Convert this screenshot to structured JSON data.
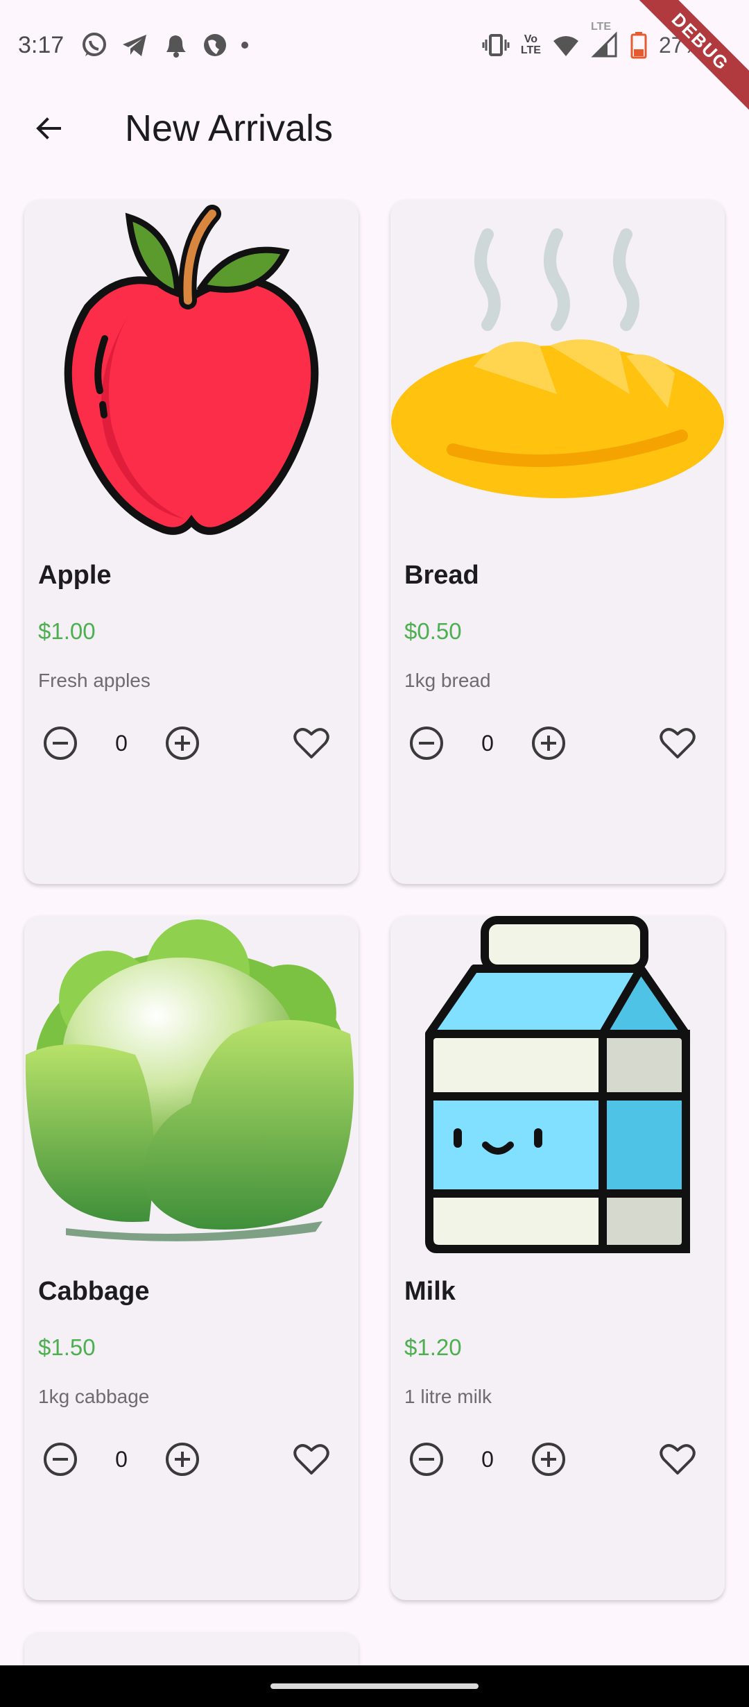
{
  "status_bar": {
    "time": "3:17",
    "battery": "27%",
    "volte_label_1": "Vo",
    "volte_label_2": "LTE",
    "lte_label": "LTE",
    "debug_label": "DEBUG",
    "icons": [
      "whatsapp-icon",
      "telegram-icon",
      "bell-icon",
      "globe-icon",
      "dot-icon",
      "vibrate-icon",
      "volte-icon",
      "wifi-icon",
      "signal-icon",
      "battery-icon"
    ]
  },
  "app_bar": {
    "title": "New Arrivals",
    "back_icon": "arrow-back-icon"
  },
  "colors": {
    "background": "#fdf7fd",
    "card": "#f5eff6",
    "price": "#4caf50",
    "description": "#6f6a72"
  },
  "products": [
    {
      "name": "Apple",
      "price": "$1.00",
      "description": "Fresh apples",
      "quantity": "0",
      "image": "apple-image"
    },
    {
      "name": "Bread",
      "price": "$0.50",
      "description": "1kg bread",
      "quantity": "0",
      "image": "bread-image"
    },
    {
      "name": "Cabbage",
      "price": "$1.50",
      "description": "1kg cabbage",
      "quantity": "0",
      "image": "cabbage-image"
    },
    {
      "name": "Milk",
      "price": "$1.20",
      "description": "1 litre milk",
      "quantity": "0",
      "image": "milk-image"
    }
  ]
}
